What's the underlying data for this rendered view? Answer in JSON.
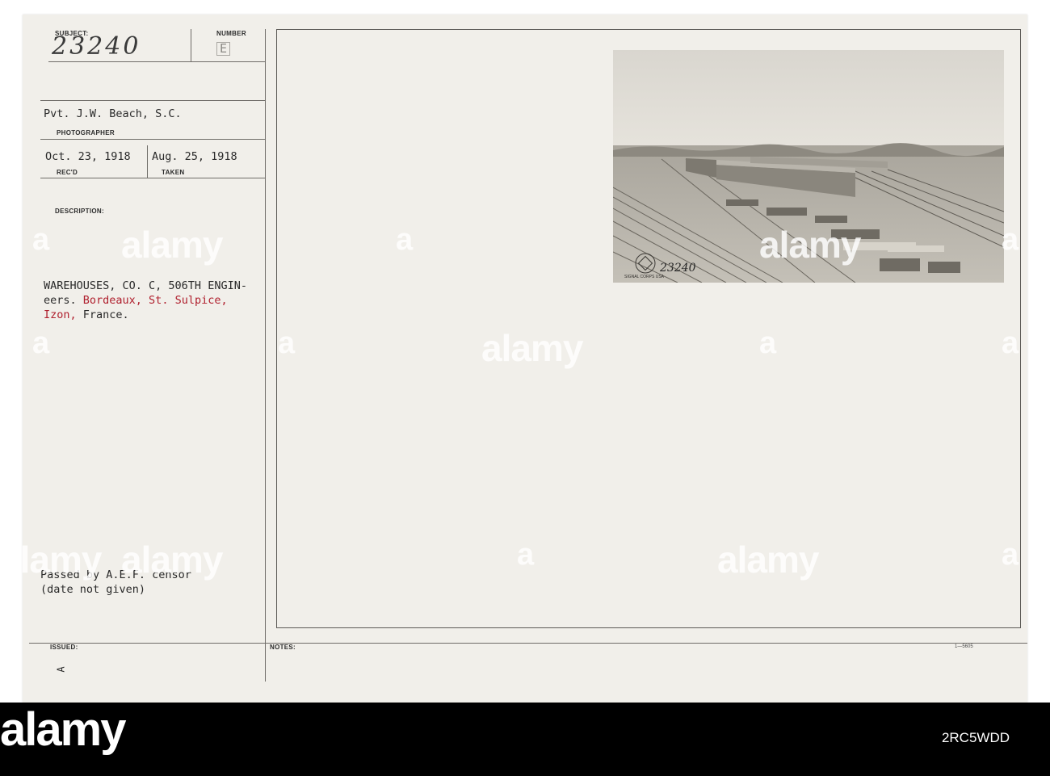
{
  "card": {
    "subject_label": "SUBJECT:",
    "subject_value": "23240",
    "number_label": "NUMBER",
    "number_value": "E",
    "photographer_name": "Pvt. J.W. Beach, S.C.",
    "photographer_label": "PHOTOGRAPHER",
    "received_date": "Oct. 23, 1918",
    "received_label": "REC'D",
    "taken_date": "Aug. 25, 1918",
    "taken_label": "TAKEN",
    "description_label": "DESCRIPTION:",
    "description_line1": "WAREHOUSES, CO. C, 506TH ENGIN-",
    "description_line2_a": "eers. ",
    "description_line2_b": "Bordeaux, St. Sulpice,",
    "description_line3_a": "Izon,",
    "description_line3_b": " France.",
    "censor_line1": "Passed by A.E.F. censor",
    "censor_line2": "(date not given)",
    "issued_label": "ISSUED:",
    "issued_mark": "A",
    "notes_label": "NOTES:",
    "form_code": "1—5605"
  },
  "photo": {
    "stamp_number": "23240",
    "stamp_text": "SIGNAL CORPS USA"
  },
  "watermark": {
    "brand": "alamy",
    "short": "a"
  },
  "footer": {
    "brand": "alamy",
    "image_code": "2RC5WDD"
  },
  "colors": {
    "card": "#f1efea",
    "ink": "#2a2a2a",
    "red_ink": "#b0202e",
    "footer": "#000000"
  }
}
